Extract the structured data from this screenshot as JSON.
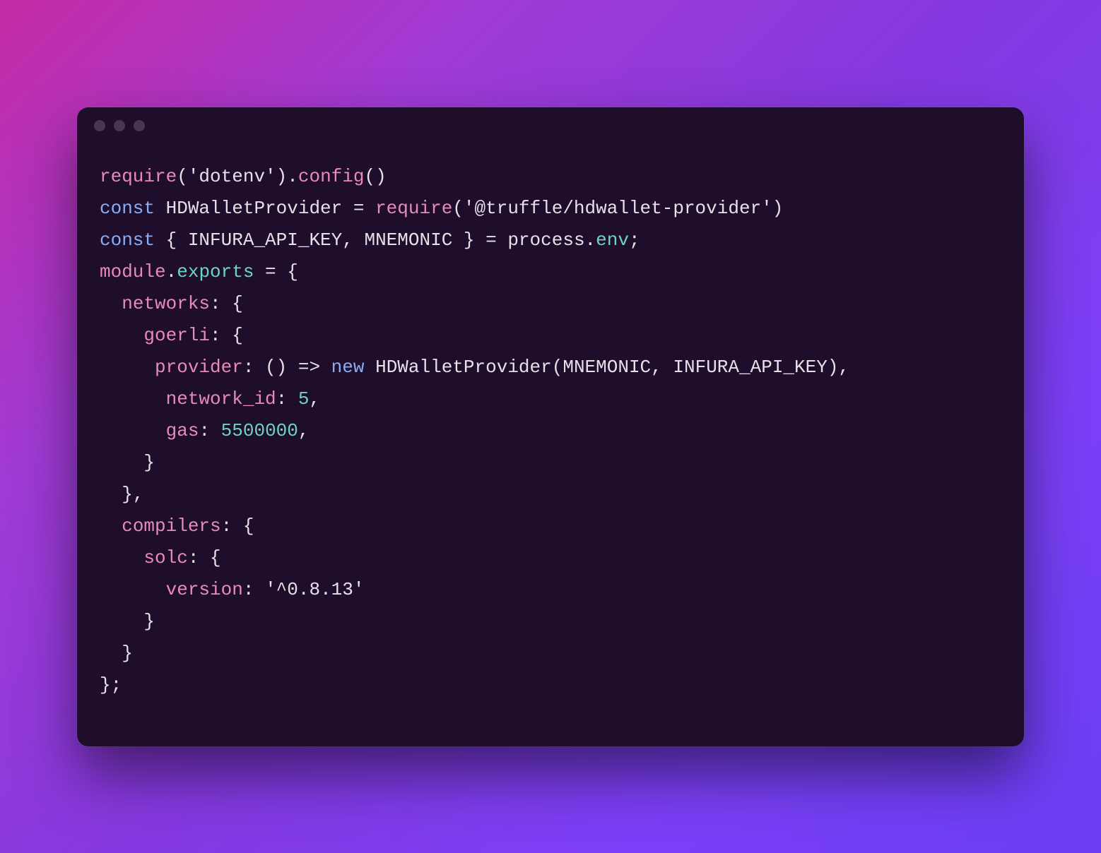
{
  "code": {
    "line1": {
      "require": "require",
      "dotenv": "'dotenv'",
      "config": "config"
    },
    "line2": {
      "const": "const",
      "name": "HDWalletProvider",
      "eq": " = ",
      "require": "require",
      "pkg": "'@truffle/hdwallet-provider'"
    },
    "line3": {
      "const": "const",
      "destruct_open": " { ",
      "infura": "INFURA_API_KEY",
      "comma": ", ",
      "mnemonic": "MNEMONIC",
      "destruct_close": " } = ",
      "process": "process",
      "dot": ".",
      "env": "env",
      "semi": ";"
    },
    "line4": {
      "module": "module",
      "dot": ".",
      "exports": "exports",
      "eq": " = {"
    },
    "line5": {
      "indent": "  ",
      "networks": "networks",
      "colon": ": {"
    },
    "line6": {
      "indent": "    ",
      "goerli": "goerli",
      "colon": ": {"
    },
    "line7": {
      "indent": "     ",
      "provider": "provider",
      "colon": ": () => ",
      "new": "new",
      "sp": " ",
      "cls": "HDWalletProvider",
      "open": "(",
      "mnemonic": "MNEMONIC",
      "comma": ", ",
      "infura": "INFURA_API_KEY",
      "close": "),"
    },
    "line8": {
      "indent": "      ",
      "network_id": "network_id",
      "colon": ": ",
      "val": "5",
      "comma": ","
    },
    "line9": {
      "indent": "      ",
      "gas": "gas",
      "colon": ": ",
      "val": "5500000",
      "comma": ","
    },
    "line10": {
      "indent": "    ",
      "close": "}"
    },
    "line11": {
      "indent": "  ",
      "close": "},"
    },
    "line12": {
      "indent": "  ",
      "compilers": "compilers",
      "colon": ": {"
    },
    "line13": {
      "indent": "    ",
      "solc": "solc",
      "colon": ": {"
    },
    "line14": {
      "indent": "      ",
      "version": "version",
      "colon": ": ",
      "val": "'^0.8.13'"
    },
    "line15": {
      "indent": "    ",
      "close": "}"
    },
    "line16": {
      "indent": "  ",
      "close": "}"
    },
    "line17": {
      "close": "};"
    }
  }
}
